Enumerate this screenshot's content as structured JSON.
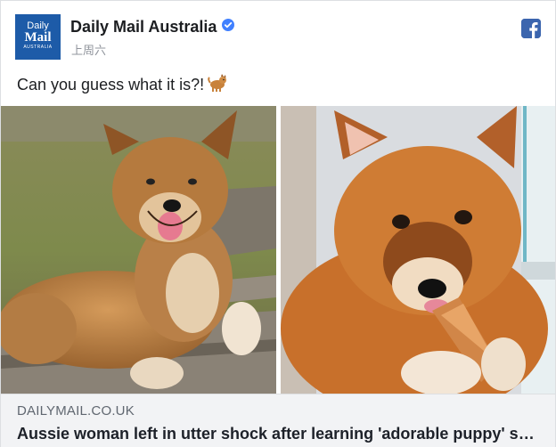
{
  "post": {
    "page_name": "Daily Mail Australia",
    "timestamp": "上周六",
    "caption": "Can you guess what it is?!",
    "caption_emoji": "dog-emoji",
    "avatar": {
      "line1": "Daily",
      "line2": "Mail",
      "line3": "AUSTRALIA"
    },
    "verified_badge": "verified-check-icon",
    "network_icon": "facebook-icon"
  },
  "link_preview": {
    "domain": "DAILYMAIL.CO.UK",
    "headline": "Aussie woman left in utter shock after learning 'adorable puppy' she took in is actually a pure-bred dingo"
  },
  "colors": {
    "brand_blue": "#1d5ba8",
    "facebook_blue": "#3b65ae",
    "verified_blue": "#4080ff",
    "link_bar_bg": "#f2f3f5"
  }
}
